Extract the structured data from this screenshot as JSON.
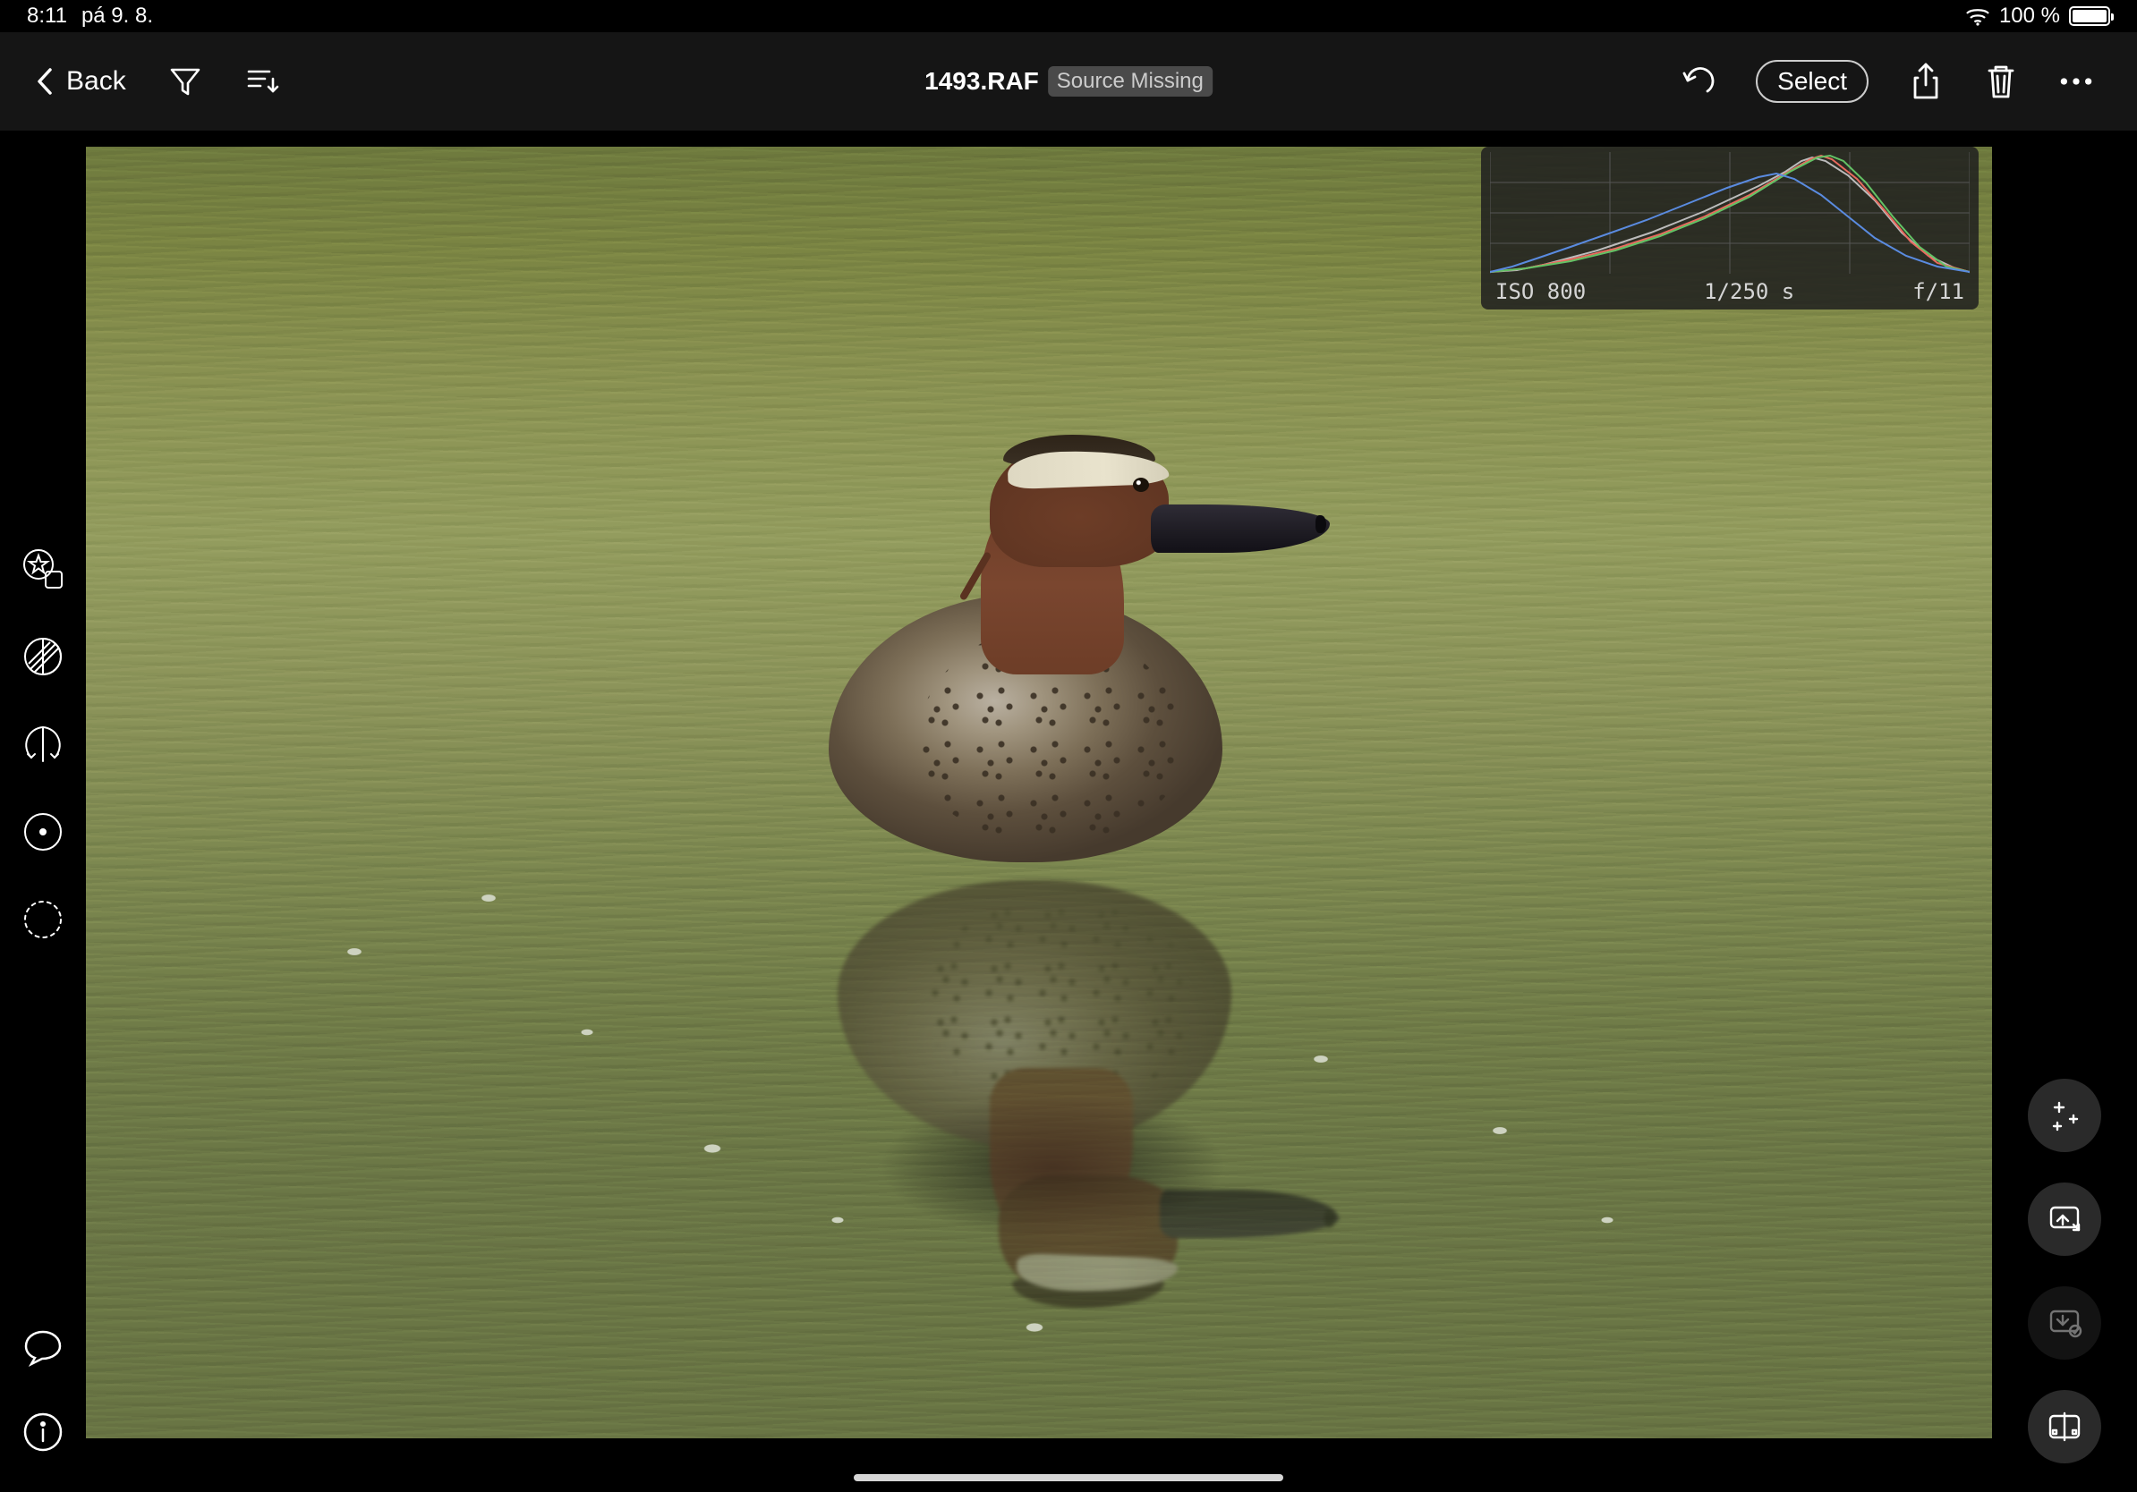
{
  "status": {
    "time": "8:11",
    "date": "pá 9. 8.",
    "battery": "100 %"
  },
  "toolbar": {
    "back_label": "Back",
    "file_title": "1493.RAF",
    "source_missing": "Source Missing",
    "select_label": "Select"
  },
  "histogram": {
    "iso": "ISO 800",
    "shutter": "1/250 s",
    "aperture": "f/11"
  }
}
